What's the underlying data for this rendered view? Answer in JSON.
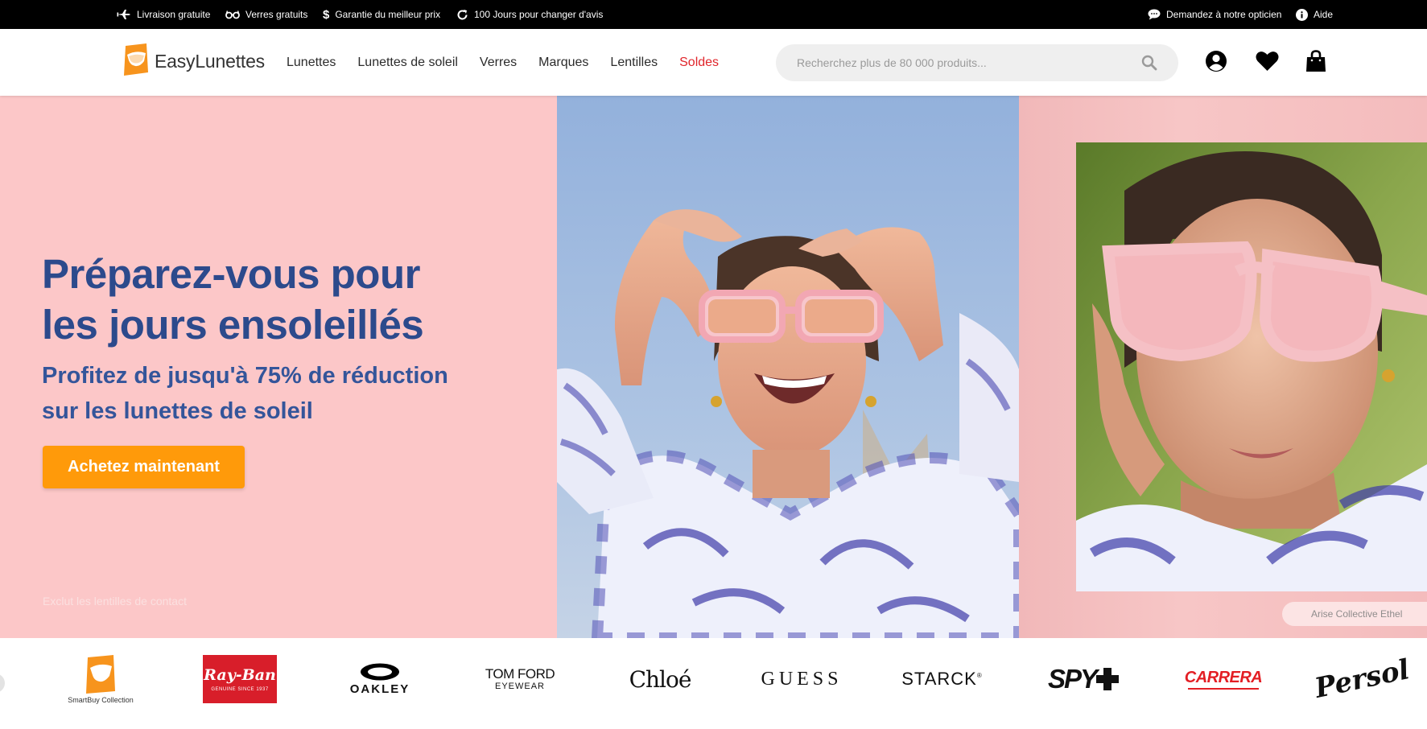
{
  "topbar": {
    "left": [
      {
        "icon": "airplane-icon",
        "label": "Livraison gratuite"
      },
      {
        "icon": "glasses-icon",
        "label": "Verres gratuits"
      },
      {
        "icon": "dollar-icon",
        "label": "Garantie du meilleur prix"
      },
      {
        "icon": "refresh-icon",
        "label": "100 Jours pour changer d'avis"
      }
    ],
    "right": [
      {
        "icon": "chat-icon",
        "label": "Demandez à notre opticien"
      },
      {
        "icon": "info-icon",
        "label": "Aide"
      }
    ]
  },
  "header": {
    "logo_text": "EasyLunettes",
    "nav": [
      {
        "label": "Lunettes"
      },
      {
        "label": "Lunettes de soleil"
      },
      {
        "label": "Verres"
      },
      {
        "label": "Marques"
      },
      {
        "label": "Lentilles"
      },
      {
        "label": "Soldes"
      }
    ],
    "search_placeholder": "Recherchez plus de 80 000 produits...",
    "icons": [
      "account-icon",
      "heart-icon",
      "shopping-bag-icon"
    ],
    "colors": {
      "sale": "#e0252b",
      "logo_orange": "#f7941d"
    }
  },
  "hero": {
    "title_line1": "Préparez-vous pour",
    "title_line2": "les jours ensoleillés",
    "subtitle_line1": "Profitez de jusqu'à 75% de réduction",
    "subtitle_line2": "sur les lunettes de soleil",
    "cta_label": "Achetez maintenant",
    "disclaimer": "Exclut les lentilles de contact",
    "photo_caption": "Arise Collective Ethel",
    "colors": {
      "background": "#fcc7c8",
      "title": "#2c4a8c",
      "cta": "#ff9a0a"
    }
  },
  "brands": {
    "smartbuy_caption": "SmartBuy Collection",
    "rayban_text": "Ray-Ban",
    "rayban_tagline": "GENUINE SINCE 1937",
    "oakley_text": "OAKLEY",
    "tomford_line1": "TOM FORD",
    "tomford_line2": "EYEWEAR",
    "chloe_text": "Chloé",
    "guess_text": "GUESS",
    "starck_text": "STARCK",
    "spy_text": "SPY",
    "carrera_text": "CARRERA",
    "persol_text": "Persol"
  }
}
